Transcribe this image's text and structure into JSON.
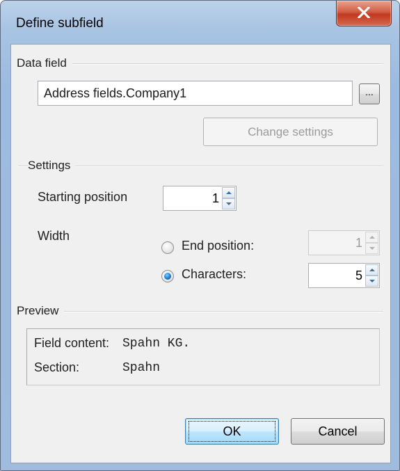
{
  "window": {
    "title": "Define subfield"
  },
  "data_field": {
    "group_label": "Data field",
    "value": "Address fields.Company1",
    "browse_label": "...",
    "change_settings_label": "Change settings"
  },
  "settings": {
    "group_label": "Settings",
    "starting_position_label": "Starting position",
    "starting_position_value": "1",
    "width_label": "Width",
    "end_position_label": "End position:",
    "end_position_value": "1",
    "characters_label": "Characters:",
    "characters_value": "5",
    "selected_option": "Characters"
  },
  "preview": {
    "group_label": "Preview",
    "field_content_label": "Field content:",
    "field_content_value": "Spahn KG.",
    "section_label": "Section:",
    "section_value": "Spahn"
  },
  "buttons": {
    "ok_label": "OK",
    "cancel_label": "Cancel"
  }
}
